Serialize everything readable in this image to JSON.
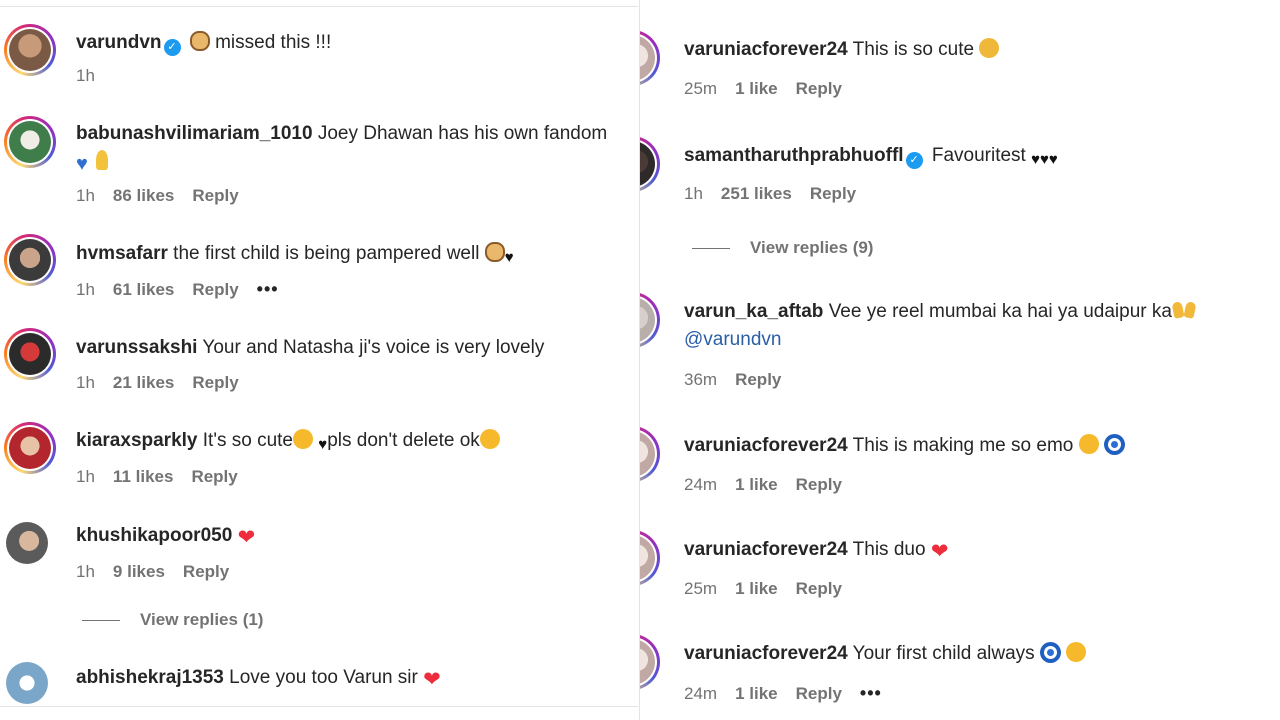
{
  "left_column": {
    "comments": [
      {
        "username": "varundvn",
        "verified": true,
        "text": " missed this !!!",
        "time": "1h",
        "likes": "",
        "reply": ""
      },
      {
        "username": "babunashvilimariam_1010",
        "verified": false,
        "text": "Joey Dhawan has his own fandom",
        "time": "1h",
        "likes": "86 likes",
        "reply": "Reply"
      },
      {
        "username": "hvmsafarr",
        "verified": false,
        "text": "the first child is being pampered well",
        "time": "1h",
        "likes": "61 likes",
        "reply": "Reply",
        "more": "•••"
      },
      {
        "username": "varunssakshi",
        "verified": false,
        "text": "Your and Natasha ji's voice is very lovely",
        "time": "1h",
        "likes": "21 likes",
        "reply": "Reply"
      },
      {
        "username": "kiaraxsparkly",
        "verified": false,
        "text_a": "It's so cute",
        "text_b": "pls don't delete ok",
        "time": "1h",
        "likes": "11 likes",
        "reply": "Reply"
      },
      {
        "username": "khushikapoor050",
        "verified": false,
        "text": "",
        "time": "1h",
        "likes": "9 likes",
        "reply": "Reply"
      },
      {
        "username": "abhishekraj1353",
        "verified": false,
        "text": "Love you too Varun sir",
        "time": "",
        "likes": "",
        "reply": ""
      }
    ],
    "view_replies": "View replies (1)"
  },
  "right_column": {
    "comments": [
      {
        "username": "varuniacforever24",
        "verified": false,
        "text": "This is so cute",
        "time": "25m",
        "likes": "1 like",
        "reply": "Reply"
      },
      {
        "username": "samantharuthprabhuoffl",
        "verified": true,
        "text": "Favouritest",
        "time": "1h",
        "likes": "251 likes",
        "reply": "Reply"
      },
      {
        "username": "varun_ka_aftab",
        "verified": false,
        "text": "Vee ye reel mumbai ka hai ya udaipur ka",
        "mention": "@varundvn",
        "time": "36m",
        "likes": "",
        "reply": "Reply"
      },
      {
        "username": "varuniacforever24",
        "verified": false,
        "text": "This is making me so emo",
        "time": "24m",
        "likes": "1 like",
        "reply": "Reply"
      },
      {
        "username": "varuniacforever24",
        "verified": false,
        "text": "This duo",
        "time": "25m",
        "likes": "1 like",
        "reply": "Reply"
      },
      {
        "username": "varuniacforever24",
        "verified": false,
        "text": "Your first child always",
        "time": "24m",
        "likes": "1 like",
        "reply": "Reply",
        "more": "•••"
      }
    ],
    "view_replies": "View replies (9)"
  },
  "icons": {
    "verified": "verified-badge-icon",
    "more": "more-options-icon",
    "heart_red": "red-heart-emoji",
    "heart_black": "black-heart-emoji"
  },
  "colors": {
    "link": "#2a5ea8",
    "muted": "#737373",
    "verified": "#1d9bf0",
    "heart": "#ed2c3c"
  }
}
